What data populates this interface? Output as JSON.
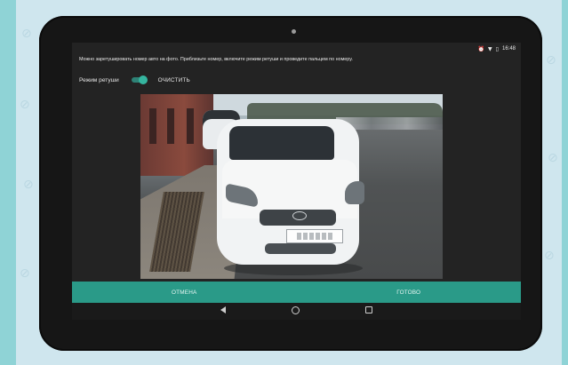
{
  "status_bar": {
    "time": "16:48",
    "icons": [
      "alarm-icon",
      "wifi-icon",
      "battery-icon"
    ]
  },
  "hint_text": "Можно заретушировать номер авто на фото. Приблизьте номер, включите режим ретуши и проведите пальцем по номеру.",
  "retouch": {
    "label": "Режим ретуши",
    "toggle_on": true,
    "accent_color": "#2a9a88"
  },
  "clear_button": "ОЧИСТИТЬ",
  "photo": {
    "icon": "car-photo"
  },
  "actions": {
    "cancel": "ОТМЕНА",
    "done": "ГОТОВО"
  },
  "navigation": {
    "back": "back-icon",
    "home": "home-icon",
    "recents": "recents-icon"
  }
}
